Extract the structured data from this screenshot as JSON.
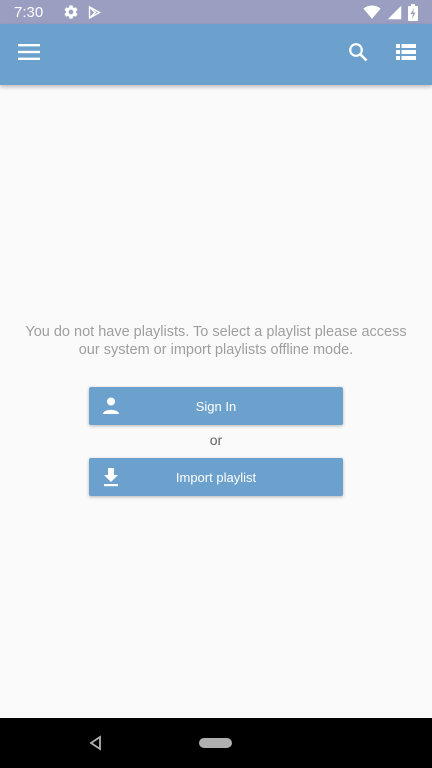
{
  "status_bar": {
    "time": "7:30",
    "left_icons": [
      "settings-icon",
      "play-store-icon"
    ],
    "right_icons": [
      "wifi-icon",
      "signal-icon",
      "battery-charging-icon"
    ]
  },
  "app_bar": {
    "icons": [
      "menu-icon",
      "search-icon",
      "list-view-icon"
    ],
    "color": "#6ba1cc"
  },
  "main": {
    "empty_message": "You do not have playlists. To select a playlist please access our system or import playlists offline mode.",
    "sign_in_label": "Sign In",
    "or_label": "or",
    "import_label": "Import playlist"
  },
  "nav_bar": {
    "icons": [
      "back-icon",
      "home-pill-icon"
    ]
  },
  "colors": {
    "status_bar": "#9a9ec0",
    "accent": "#6ba1cc",
    "background": "#fafafa",
    "message_text": "#9e9e9e"
  }
}
